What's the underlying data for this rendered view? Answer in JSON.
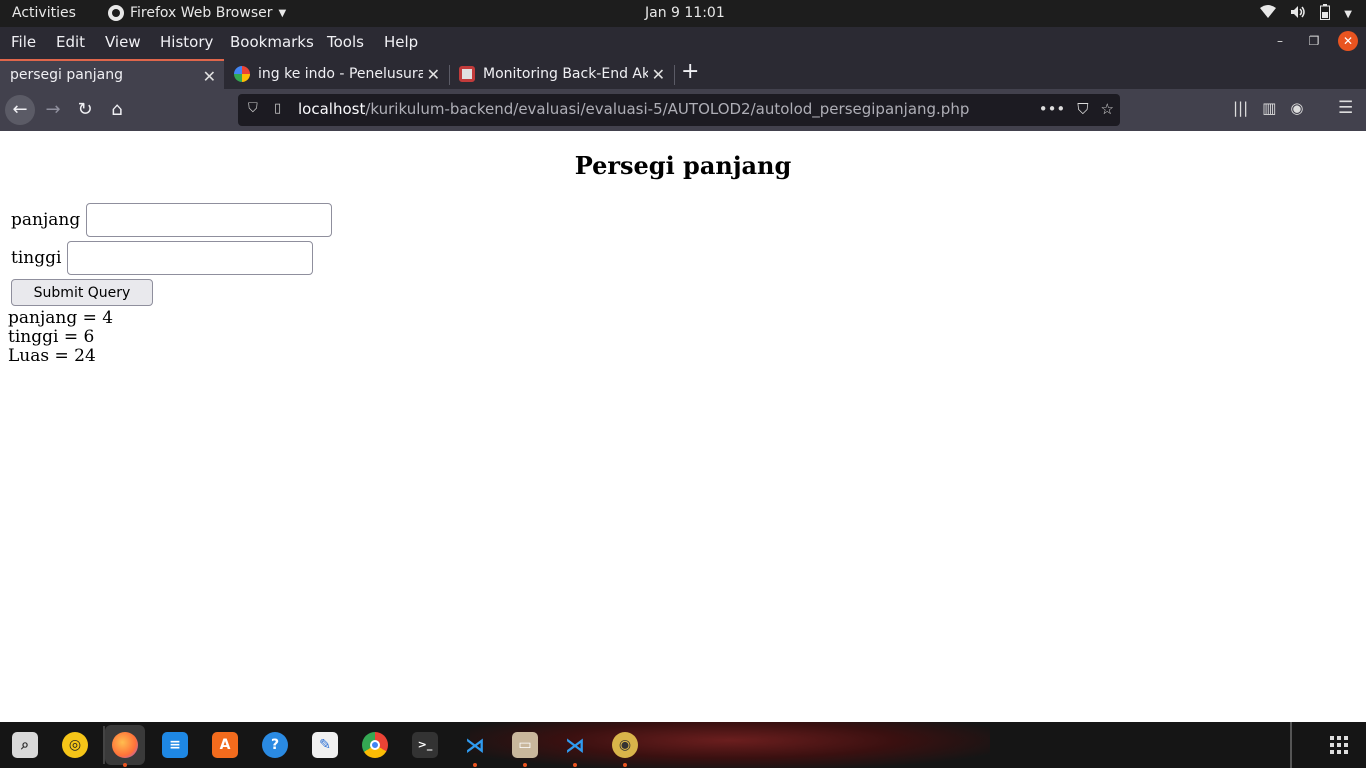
{
  "topbar": {
    "activities": "Activities",
    "app_name": "Firefox Web Browser",
    "clock": "Jan 9  11:01",
    "tray_icons": [
      "wifi-icon",
      "volume-icon",
      "battery-icon",
      "system-menu-caret-icon"
    ]
  },
  "menubar": {
    "items": [
      "File",
      "Edit",
      "View",
      "History",
      "Bookmarks",
      "Tools",
      "Help"
    ]
  },
  "tabs": [
    {
      "title": "persegi panjang",
      "active": true,
      "favicon": "none"
    },
    {
      "title": "ing ke indo - Penelusuran",
      "active": false,
      "favicon": "google-icon"
    },
    {
      "title": "Monitoring Back-End Akl",
      "active": false,
      "favicon": "trello-icon"
    }
  ],
  "navbar": {
    "url_host": "localhost",
    "url_path": "/kurikulum-backend/evaluasi/evaluasi-5/AUTOLOD2/autolod_persegipanjang.php"
  },
  "page": {
    "heading": "Persegi panjang",
    "label_panjang": "panjang",
    "label_tinggi": "tinggi",
    "value_panjang": "",
    "value_tinggi": "",
    "submit_label": "Submit Query",
    "result_panjang": "panjang = 4",
    "result_tinggi": "tinggi = 6",
    "result_luas": "Luas = 24"
  },
  "dock": {
    "apps": [
      "search-icon",
      "rhythmbox-icon",
      "firefox-icon",
      "writer-icon",
      "software-center-icon",
      "help-icon",
      "text-editor-icon",
      "chrome-icon",
      "terminal-icon",
      "vscode-icon",
      "files-icon",
      "vscode-icon",
      "gimp-icon"
    ],
    "show_apps": "show-applications-icon"
  },
  "colors": {
    "accent": "#e95420",
    "tab_active_line": "#e0664b",
    "chrome_bg": "#2b2a33",
    "toolbar_bg": "#42414d"
  }
}
